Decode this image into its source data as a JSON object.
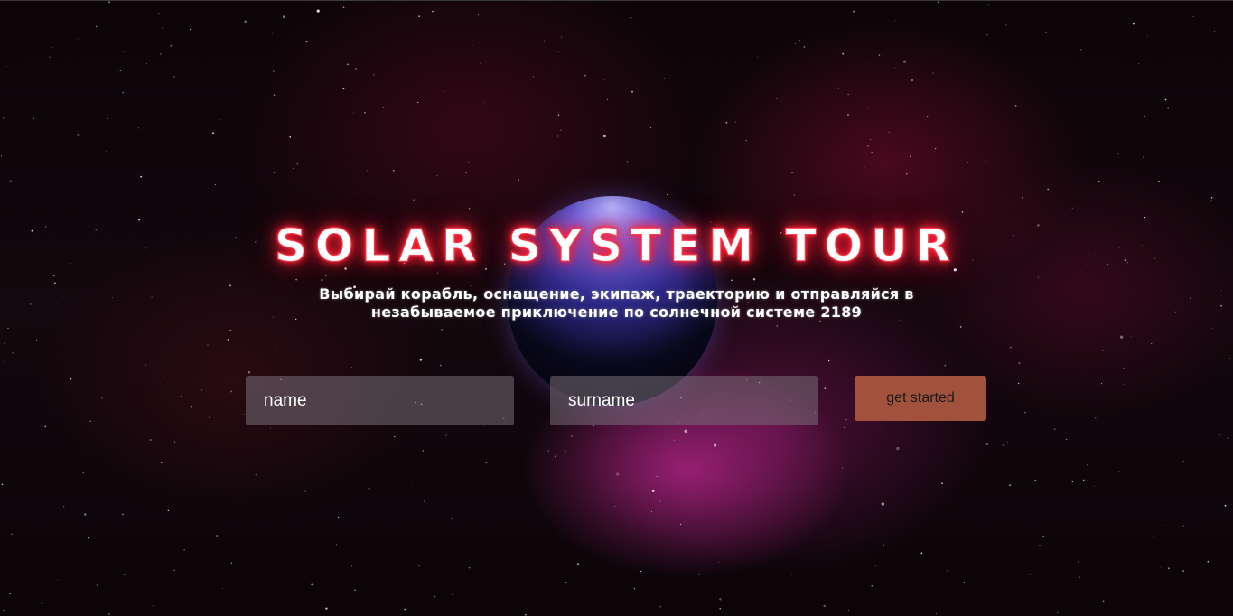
{
  "hero": {
    "title": "SOLAR SYSTEM TOUR",
    "subtitle": "Выбирай корабль, оснащение, экипаж, траекторию и отправляйся в незабываемое приключение по солнечной системе 2189"
  },
  "form": {
    "name_placeholder": "name",
    "surname_placeholder": "surname",
    "submit_label": "get started"
  },
  "colors": {
    "title_glow": "#ff2a3c",
    "button_bg": "#a2523c",
    "nebula_magenta": "#c42896",
    "planet_rim": "#6b63e6"
  }
}
